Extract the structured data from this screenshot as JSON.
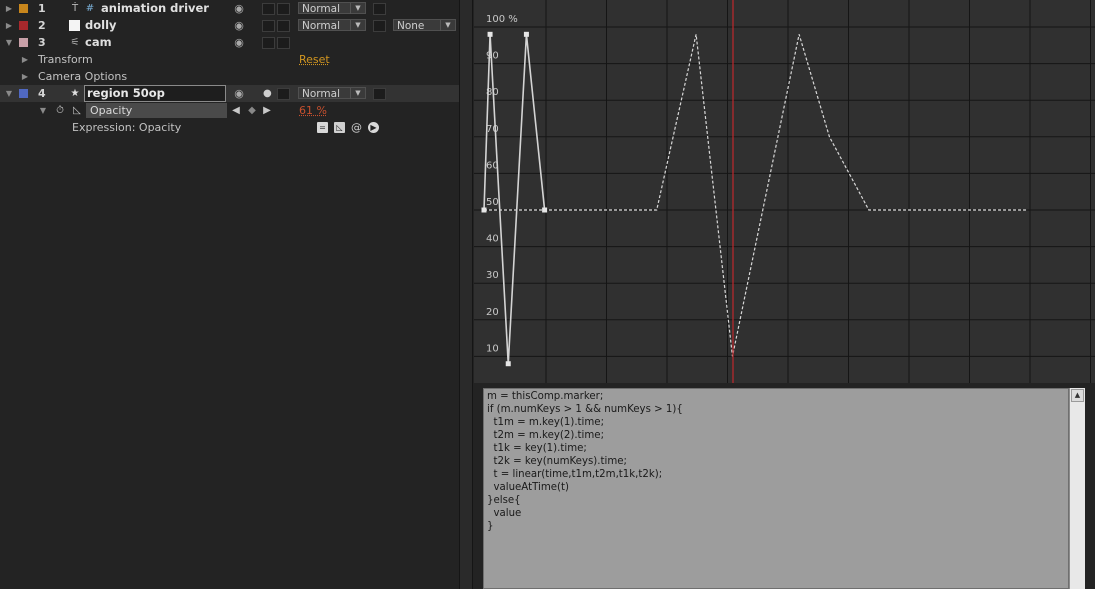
{
  "layers": [
    {
      "num": "1",
      "name": "animation driver",
      "color": "#c8861c",
      "type_icon": "text-null-icon",
      "mode": "Normal",
      "expanded": false
    },
    {
      "num": "2",
      "name": "dolly",
      "color": "#a8282c",
      "type_icon": "solid-icon",
      "mode": "Normal",
      "trkmat": "None",
      "expanded": false
    },
    {
      "num": "3",
      "name": "cam",
      "color": "#c8a0a8",
      "type_icon": "camera-icon",
      "expanded": true
    },
    {
      "num": "4",
      "name": "region 50op",
      "color": "#5068c0",
      "type_icon": "star-icon",
      "mode": "Normal",
      "expanded": true,
      "selected": true
    }
  ],
  "cam_children": {
    "transform": "Transform",
    "transform_reset": "Reset",
    "camera_options": "Camera Options"
  },
  "opacity": {
    "label": "Opacity",
    "value": "61 %",
    "expression_label": "Expression: Opacity"
  },
  "graph": {
    "y_ticks": [
      "100 %",
      "90",
      "80",
      "70",
      "60",
      "50",
      "40",
      "30",
      "20",
      "10"
    ],
    "time_indicator_color": "#c0282c",
    "solid_curve": [
      [
        0,
        50
      ],
      [
        0.2,
        98
      ],
      [
        0.8,
        8
      ],
      [
        1.4,
        98
      ],
      [
        2,
        50
      ]
    ],
    "dashed_curve": [
      [
        0,
        50
      ],
      [
        5.7,
        50
      ],
      [
        7,
        98
      ],
      [
        8.2,
        10
      ],
      [
        10.4,
        98
      ],
      [
        11.4,
        70
      ],
      [
        12.7,
        50
      ],
      [
        17.9,
        50
      ]
    ]
  },
  "expression_code": "m = thisComp.marker;\nif (m.numKeys > 1 && numKeys > 1){\n  t1m = m.key(1).time;\n  t2m = m.key(2).time;\n  t1k = key(1).time;\n  t2k = key(numKeys).time;\n  t = linear(time,t1m,t2m,t1k,t2k);\n  valueAtTime(t)\n}else{\n  value\n}"
}
